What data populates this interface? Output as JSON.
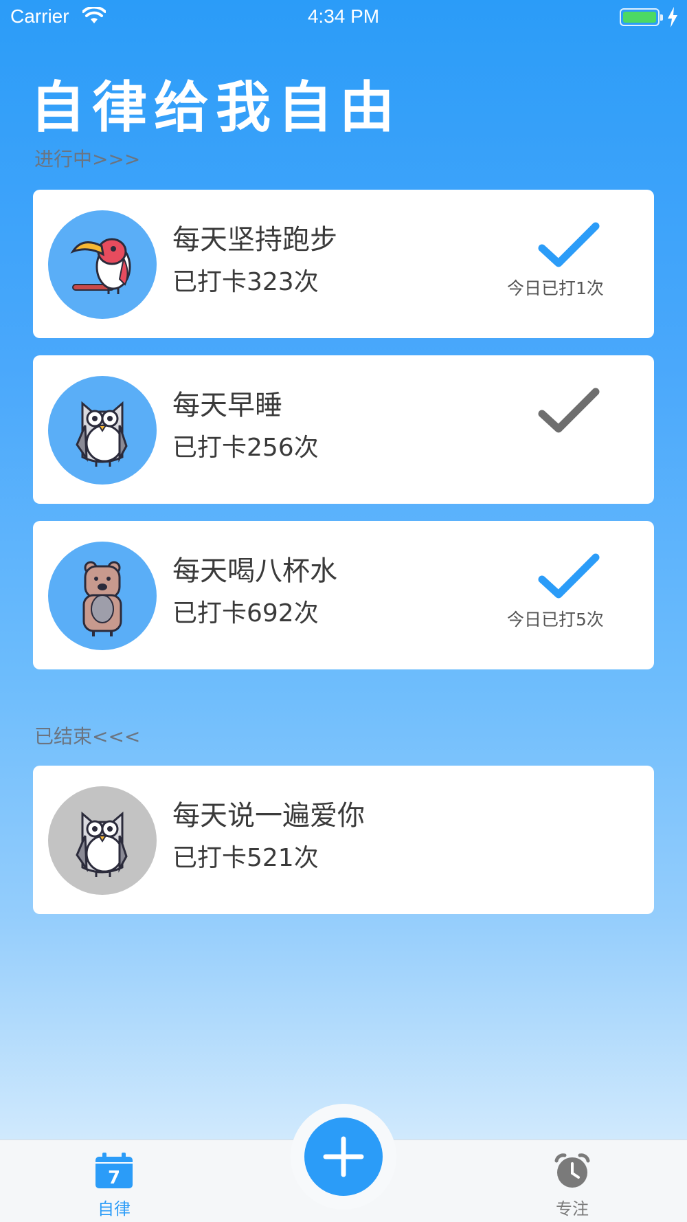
{
  "status_bar": {
    "carrier": "Carrier",
    "time": "4:34 PM",
    "icons": [
      "wifi-icon",
      "battery-icon",
      "charging-icon"
    ]
  },
  "page": {
    "title": "自律给我自由"
  },
  "sections": {
    "active_label": "进行中>>>",
    "ended_label": "已结束<<<"
  },
  "active_tasks": [
    {
      "name": "每天坚持跑步",
      "count": "已打卡323次",
      "avatar": "toucan-icon",
      "checked_today": true,
      "today_text": "今日已打1次",
      "check_color": "#2b9cf8"
    },
    {
      "name": "每天早睡",
      "count": "已打卡256次",
      "avatar": "owl-icon",
      "checked_today": false,
      "today_text": "",
      "check_color": "#6e6e6e"
    },
    {
      "name": "每天喝八杯水",
      "count": "已打卡692次",
      "avatar": "bear-icon",
      "checked_today": true,
      "today_text": "今日已打5次",
      "check_color": "#2b9cf8"
    }
  ],
  "ended_tasks": [
    {
      "name": "每天说一遍爱你",
      "count": "已打卡521次",
      "avatar": "owl-icon"
    }
  ],
  "tab_bar": {
    "discipline_label": "自律",
    "discipline_icon_text": "7",
    "focus_label": "专注",
    "add_icon": "plus-icon"
  },
  "colors": {
    "accent": "#2b9cf8",
    "avatar_active": "#5aaef7",
    "avatar_ended": "#c3c3c3",
    "unchecked": "#6e6e6e"
  }
}
